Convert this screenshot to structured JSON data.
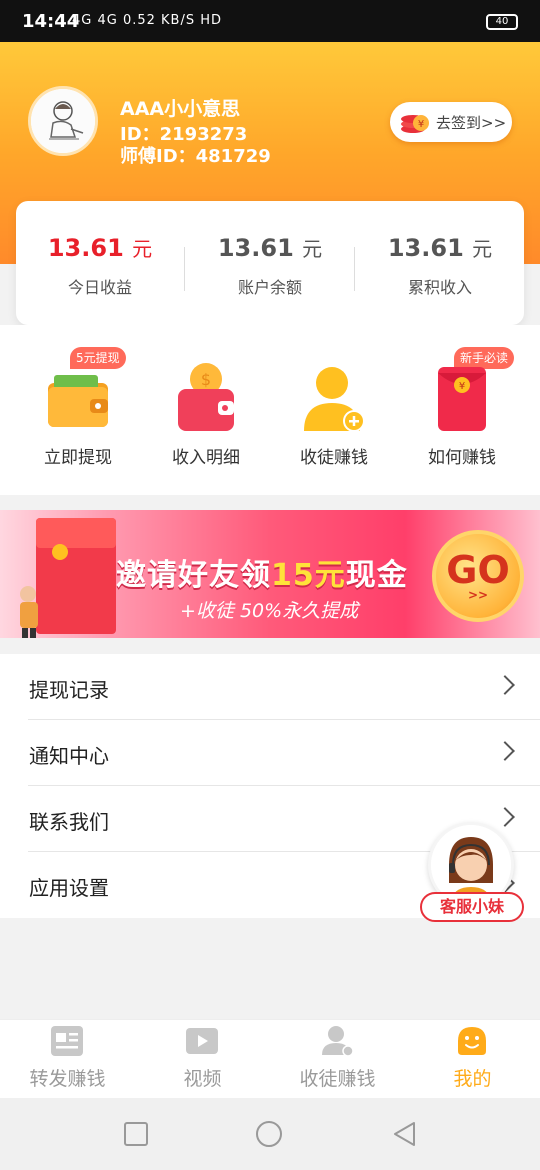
{
  "status_bar": {
    "time": "14:44",
    "network": "4G 4G 0.52 KB/S HD",
    "battery": "40"
  },
  "profile": {
    "name": "AAA小小意思",
    "id_text": "ID：2193273",
    "master_id_text": "师傅ID：481729",
    "checkin_label": "去签到>>"
  },
  "stats": [
    {
      "value": "13.61",
      "unit": "元",
      "label": "今日收益",
      "color": "#e8202a"
    },
    {
      "value": "13.61",
      "unit": "元",
      "label": "账户余额",
      "color": "#555555"
    },
    {
      "value": "13.61",
      "unit": "元",
      "label": "累积收入",
      "color": "#555555"
    }
  ],
  "shortcuts": [
    {
      "label": "立即提现",
      "badge": "5元提现",
      "icon": "wallet-icon"
    },
    {
      "label": "收入明细",
      "badge": "",
      "icon": "coin-wallet-icon"
    },
    {
      "label": "收徒赚钱",
      "badge": "",
      "icon": "add-user-icon"
    },
    {
      "label": "如何赚钱",
      "badge": "新手必读",
      "icon": "red-envelope-icon"
    }
  ],
  "banner": {
    "title_part1": "邀请好友领",
    "title_highlight": "15元",
    "title_part2": "现金",
    "subtitle": "+收徒 50%永久提成",
    "go_label": "GO",
    "go_arrows": ">>"
  },
  "menu": [
    {
      "label": "提现记录"
    },
    {
      "label": "通知中心"
    },
    {
      "label": "联系我们"
    },
    {
      "label": "应用设置"
    }
  ],
  "customer_service": {
    "label": "客服小妹"
  },
  "tabs": [
    {
      "label": "转发赚钱",
      "icon": "article-icon",
      "active": false
    },
    {
      "label": "视频",
      "icon": "video-icon",
      "active": false
    },
    {
      "label": "收徒赚钱",
      "icon": "user-icon",
      "active": false
    },
    {
      "label": "我的",
      "icon": "smiley-icon",
      "active": true
    }
  ],
  "colors": {
    "accent": "#ffab19",
    "highlight_red": "#e8202a",
    "header_top": "#ffc93a",
    "header_bottom": "#ff8a2a"
  }
}
